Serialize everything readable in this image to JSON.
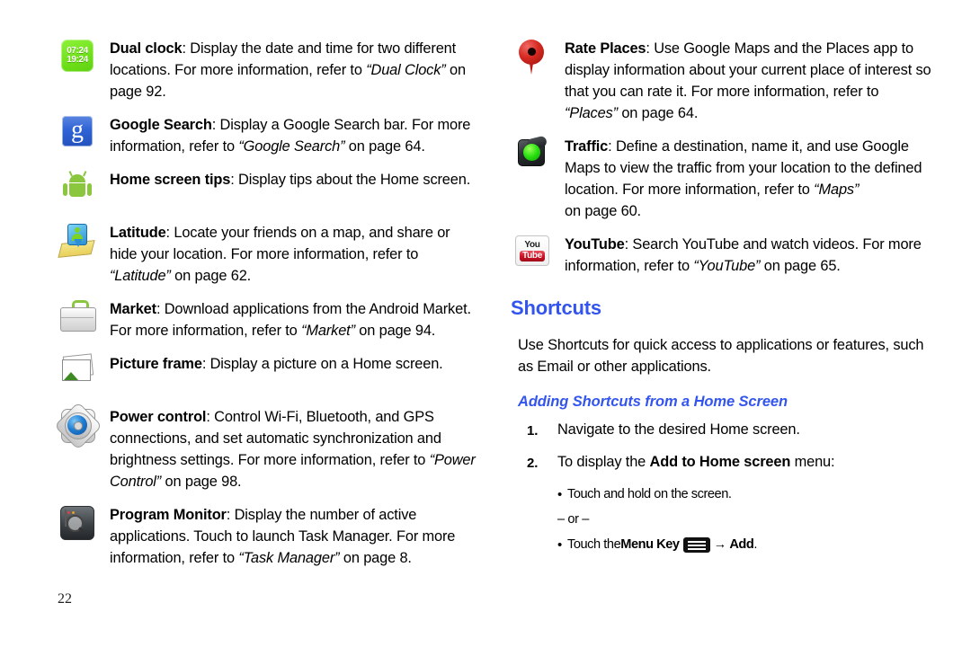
{
  "page_number": "22",
  "left_column": {
    "entries": [
      {
        "icon": "dual-clock-icon",
        "icon_text_top": "07:24",
        "icon_text_bottom": "19:24",
        "term": "Dual clock",
        "body_1": ": Display the date and time for two different locations. For more information, refer to ",
        "ref": "“Dual Clock”",
        "body_2": " on page 92."
      },
      {
        "icon": "google-search-icon",
        "icon_glyph": "g",
        "term": "Google Search",
        "body_1": ": Display a Google Search bar. For more information, refer to ",
        "ref": "“Google Search”",
        "body_2": " on page 64."
      },
      {
        "icon": "android-robot-icon",
        "term": "Home screen tips",
        "body_1": ": Display tips about the Home screen.",
        "ref": "",
        "body_2": ""
      },
      {
        "icon": "latitude-icon",
        "term": "Latitude",
        "body_1": ": Locate your friends on a map, and share or hide your location. For more information, refer to ",
        "ref": "“Latitude”",
        "body_2": " on page 62."
      },
      {
        "icon": "market-briefcase-icon",
        "term": "Market",
        "body_1": ": Download applications from the Android Market. For more information, refer to ",
        "ref": "“Market”",
        "body_2": " on page 94."
      },
      {
        "icon": "picture-frame-icon",
        "term": "Picture frame",
        "body_1": ": Display a picture on a Home screen.",
        "ref": "",
        "body_2": ""
      },
      {
        "icon": "power-control-gear-icon",
        "term": "Power control",
        "body_1": ": Control Wi-Fi, Bluetooth, and GPS connections, and set automatic synchronization and brightness settings. For more information, refer to ",
        "ref": "“Power Control”",
        "body_2": " on page 98."
      },
      {
        "icon": "program-monitor-icon",
        "term": "Program Monitor",
        "body_1": ": Display the number of active applications. Touch to launch Task Manager. For more information, refer to ",
        "ref": "“Task Manager”",
        "body_2": " on page 8."
      }
    ]
  },
  "right_column": {
    "entries": [
      {
        "icon": "map-pin-icon",
        "term": "Rate Places",
        "body_1": ": Use Google Maps and the Places app to display information about your current place of interest so that you can rate it. For more information, refer to ",
        "ref": "“Places”",
        "body_2": " on page 64."
      },
      {
        "icon": "traffic-light-icon",
        "term": "Traffic",
        "body_1": ": Define a destination, name it, and use Google Maps to view the traffic from your location to the defined location. For more information, refer to ",
        "ref": "“Maps”",
        "body_2": "",
        "continuation": "on page 60."
      },
      {
        "icon": "youtube-icon",
        "term": "YouTube",
        "body_1": ": Search YouTube and watch videos. For more information, refer to ",
        "ref": "“YouTube”",
        "body_2": " on page 65."
      }
    ],
    "section": {
      "heading": "Shortcuts",
      "intro": "Use Shortcuts for quick access to applications or features, such as Email or other applications.",
      "subheading": "Adding Shortcuts from a Home Screen",
      "steps": [
        {
          "num": "1.",
          "text": "Navigate to the desired Home screen."
        },
        {
          "num": "2.",
          "text_before": "To display the ",
          "bold": "Add to Home screen",
          "text_after": " menu:"
        }
      ],
      "bullets": [
        {
          "type": "bullet",
          "text": "Touch and hold on the screen."
        },
        {
          "type": "or",
          "text": "– or –"
        },
        {
          "type": "bullet-menu",
          "text_before": "Touch the ",
          "bold_1": "Menu Key",
          "icon": "menu-key-icon",
          "arrow": "→",
          "bold_2": "Add",
          "text_after": "."
        }
      ]
    }
  },
  "colors": {
    "heading_blue": "#3355ee",
    "text_black": "#000000",
    "page_background": "#ffffff"
  }
}
